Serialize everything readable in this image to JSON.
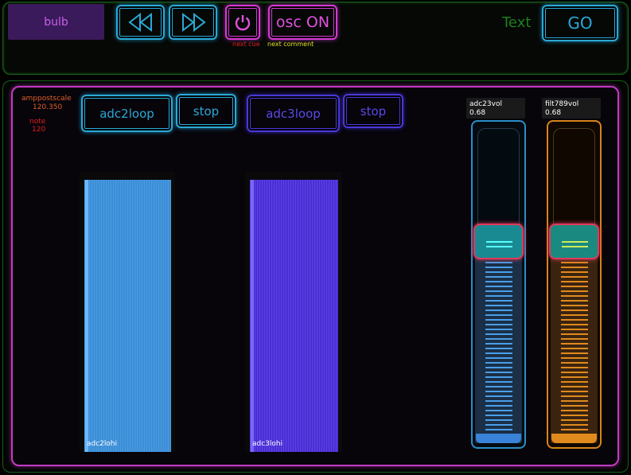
{
  "top": {
    "bulb_label": "bulb",
    "rewind_icon": "rewind-icon",
    "fastforward_icon": "fast-forward-icon",
    "power_icon": "power-icon",
    "osc_label": "osc ON",
    "next_cue": "next cue",
    "next_comment": "next comment",
    "text_label": "Text",
    "go_label": "GO"
  },
  "params": {
    "amppostscale_label": "amppostscale",
    "amppostscale_value": "120.350",
    "note_label": "note",
    "note_value": "120"
  },
  "buttons": {
    "adc2loop": "adc2loop",
    "stop1": "stop",
    "adc3loop": "adc3loop",
    "stop2": "stop"
  },
  "meters": {
    "adc2_label": "adc2lohi",
    "adc3_label": "adc3lohi"
  },
  "faders": {
    "adc23_label": "adc23vol",
    "adc23_value": "0.68",
    "adc23_level": 0.68,
    "filt789_label": "filt789vol",
    "filt789_value": "0.68",
    "filt789_level": 0.68
  },
  "colors": {
    "cyan": "#2aa9d6",
    "pink": "#d53ad5",
    "blue": "#4a38d8",
    "orange": "#e08a1e",
    "green_text": "#1f7d1f",
    "handle_red": "#e03a5a"
  }
}
